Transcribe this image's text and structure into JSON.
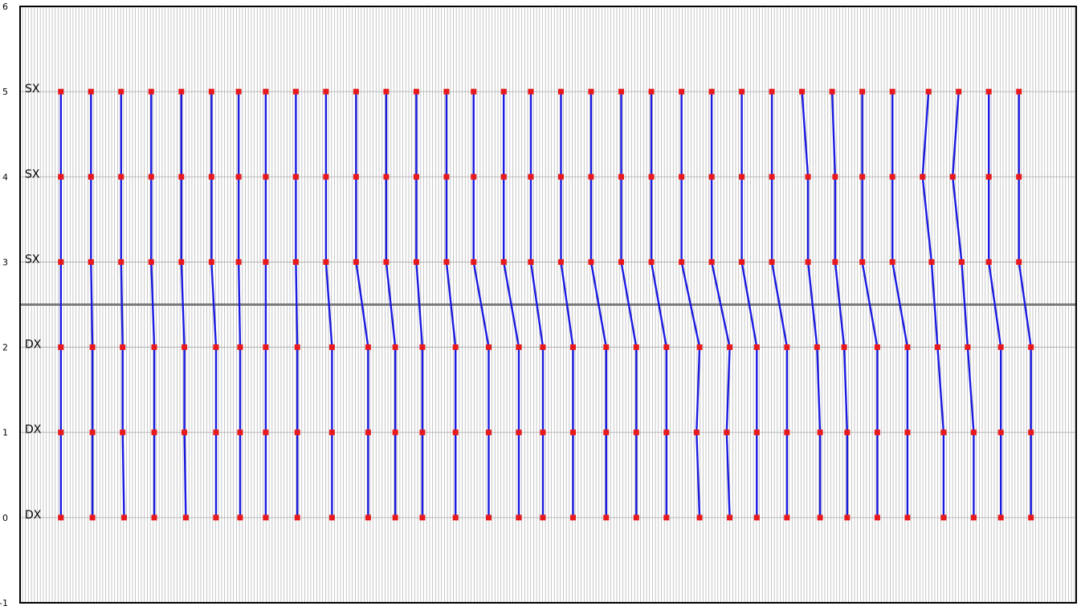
{
  "chart_data": {
    "type": "line",
    "title": "",
    "xlabel": "",
    "ylabel": "",
    "ylim": [
      -1,
      6
    ],
    "xlim": [
      -0.5,
      34.5
    ],
    "y_ticks": [
      "-1",
      "0",
      "1",
      "2",
      "3",
      "4",
      "5",
      "6"
    ],
    "row_labels": [
      {
        "y": 5,
        "text": "SX"
      },
      {
        "y": 4,
        "text": "SX"
      },
      {
        "y": 3,
        "text": "SX"
      },
      {
        "y": 2,
        "text": "DX"
      },
      {
        "y": 1,
        "text": "DX"
      },
      {
        "y": 0,
        "text": "DX"
      }
    ],
    "divider_y": 2.5,
    "grid": true,
    "marker_color": "#e8191c",
    "line_color": "#1a1ae0",
    "series": [
      {
        "points": [
          [
            0.0,
            5
          ],
          [
            0.0,
            4
          ],
          [
            0.0,
            3
          ],
          [
            0.0,
            2
          ],
          [
            0.0,
            1
          ],
          [
            0.0,
            0
          ]
        ]
      },
      {
        "points": [
          [
            1.0,
            5
          ],
          [
            1.0,
            4
          ],
          [
            1.0,
            3
          ],
          [
            1.05,
            2
          ],
          [
            1.05,
            1
          ],
          [
            1.05,
            0
          ]
        ]
      },
      {
        "points": [
          [
            2.0,
            5
          ],
          [
            2.0,
            4
          ],
          [
            2.0,
            3
          ],
          [
            2.05,
            2
          ],
          [
            2.05,
            1
          ],
          [
            2.1,
            0
          ]
        ]
      },
      {
        "points": [
          [
            3.0,
            5
          ],
          [
            3.0,
            4
          ],
          [
            3.0,
            3
          ],
          [
            3.1,
            2
          ],
          [
            3.1,
            1
          ],
          [
            3.1,
            0
          ]
        ]
      },
      {
        "points": [
          [
            4.0,
            5
          ],
          [
            4.0,
            4
          ],
          [
            4.0,
            3
          ],
          [
            4.1,
            2
          ],
          [
            4.1,
            1
          ],
          [
            4.15,
            0
          ]
        ]
      },
      {
        "points": [
          [
            5.0,
            5
          ],
          [
            5.0,
            4
          ],
          [
            5.0,
            3
          ],
          [
            5.15,
            2
          ],
          [
            5.15,
            1
          ],
          [
            5.15,
            0
          ]
        ]
      },
      {
        "points": [
          [
            5.9,
            5
          ],
          [
            5.9,
            4
          ],
          [
            5.9,
            3
          ],
          [
            5.95,
            2
          ],
          [
            5.95,
            1
          ],
          [
            5.95,
            0
          ]
        ]
      },
      {
        "points": [
          [
            6.8,
            5
          ],
          [
            6.8,
            4
          ],
          [
            6.8,
            3
          ],
          [
            6.8,
            2
          ],
          [
            6.8,
            1
          ],
          [
            6.8,
            0
          ]
        ]
      },
      {
        "points": [
          [
            7.8,
            5
          ],
          [
            7.8,
            4
          ],
          [
            7.8,
            3
          ],
          [
            7.85,
            2
          ],
          [
            7.85,
            1
          ],
          [
            7.85,
            0
          ]
        ]
      },
      {
        "points": [
          [
            8.8,
            5
          ],
          [
            8.8,
            4
          ],
          [
            8.8,
            3
          ],
          [
            9.0,
            2
          ],
          [
            9.0,
            1
          ],
          [
            9.0,
            0
          ]
        ]
      },
      {
        "points": [
          [
            9.8,
            5
          ],
          [
            9.8,
            4
          ],
          [
            9.8,
            3
          ],
          [
            10.2,
            2
          ],
          [
            10.2,
            1
          ],
          [
            10.2,
            0
          ]
        ]
      },
      {
        "points": [
          [
            10.8,
            5
          ],
          [
            10.8,
            4
          ],
          [
            10.8,
            3
          ],
          [
            11.1,
            2
          ],
          [
            11.1,
            1
          ],
          [
            11.1,
            0
          ]
        ]
      },
      {
        "points": [
          [
            11.8,
            5
          ],
          [
            11.8,
            4
          ],
          [
            11.8,
            3
          ],
          [
            12.0,
            2
          ],
          [
            12.0,
            1
          ],
          [
            12.0,
            0
          ]
        ]
      },
      {
        "points": [
          [
            12.8,
            5
          ],
          [
            12.8,
            4
          ],
          [
            12.8,
            3
          ],
          [
            13.1,
            2
          ],
          [
            13.1,
            1
          ],
          [
            13.1,
            0
          ]
        ]
      },
      {
        "points": [
          [
            13.7,
            5
          ],
          [
            13.7,
            4
          ],
          [
            13.7,
            3
          ],
          [
            14.2,
            2
          ],
          [
            14.2,
            1
          ],
          [
            14.2,
            0
          ]
        ]
      },
      {
        "points": [
          [
            14.7,
            5
          ],
          [
            14.7,
            4
          ],
          [
            14.7,
            3
          ],
          [
            15.2,
            2
          ],
          [
            15.2,
            1
          ],
          [
            15.2,
            0
          ]
        ]
      },
      {
        "points": [
          [
            15.6,
            5
          ],
          [
            15.6,
            4
          ],
          [
            15.6,
            3
          ],
          [
            16.0,
            2
          ],
          [
            16.0,
            1
          ],
          [
            16.0,
            0
          ]
        ]
      },
      {
        "points": [
          [
            16.6,
            5
          ],
          [
            16.6,
            4
          ],
          [
            16.6,
            3
          ],
          [
            17.0,
            2
          ],
          [
            17.0,
            1
          ],
          [
            17.0,
            0
          ]
        ]
      },
      {
        "points": [
          [
            17.6,
            5
          ],
          [
            17.6,
            4
          ],
          [
            17.6,
            3
          ],
          [
            18.1,
            2
          ],
          [
            18.1,
            1
          ],
          [
            18.1,
            0
          ]
        ]
      },
      {
        "points": [
          [
            18.6,
            5
          ],
          [
            18.6,
            4
          ],
          [
            18.6,
            3
          ],
          [
            19.1,
            2
          ],
          [
            19.1,
            1
          ],
          [
            19.1,
            0
          ]
        ]
      },
      {
        "points": [
          [
            19.6,
            5
          ],
          [
            19.6,
            4
          ],
          [
            19.6,
            3
          ],
          [
            20.1,
            2
          ],
          [
            20.1,
            1
          ],
          [
            20.1,
            0
          ]
        ]
      },
      {
        "points": [
          [
            20.6,
            5
          ],
          [
            20.6,
            4
          ],
          [
            20.6,
            3
          ],
          [
            21.2,
            2
          ],
          [
            21.1,
            1
          ],
          [
            21.2,
            0
          ]
        ]
      },
      {
        "points": [
          [
            21.6,
            5
          ],
          [
            21.6,
            4
          ],
          [
            21.6,
            3
          ],
          [
            22.2,
            2
          ],
          [
            22.1,
            1
          ],
          [
            22.2,
            0
          ]
        ]
      },
      {
        "points": [
          [
            22.6,
            5
          ],
          [
            22.6,
            4
          ],
          [
            22.6,
            3
          ],
          [
            23.1,
            2
          ],
          [
            23.1,
            1
          ],
          [
            23.1,
            0
          ]
        ]
      },
      {
        "points": [
          [
            23.6,
            5
          ],
          [
            23.6,
            4
          ],
          [
            23.6,
            3
          ],
          [
            24.1,
            2
          ],
          [
            24.1,
            1
          ],
          [
            24.1,
            0
          ]
        ]
      },
      {
        "points": [
          [
            24.6,
            5
          ],
          [
            24.8,
            4
          ],
          [
            24.8,
            3
          ],
          [
            25.1,
            2
          ],
          [
            25.2,
            1
          ],
          [
            25.2,
            0
          ]
        ]
      },
      {
        "points": [
          [
            25.6,
            5
          ],
          [
            25.7,
            4
          ],
          [
            25.7,
            3
          ],
          [
            26.0,
            2
          ],
          [
            26.1,
            1
          ],
          [
            26.1,
            0
          ]
        ]
      },
      {
        "points": [
          [
            26.6,
            5
          ],
          [
            26.6,
            4
          ],
          [
            26.6,
            3
          ],
          [
            27.1,
            2
          ],
          [
            27.1,
            1
          ],
          [
            27.1,
            0
          ]
        ]
      },
      {
        "points": [
          [
            27.6,
            5
          ],
          [
            27.6,
            4
          ],
          [
            27.6,
            3
          ],
          [
            28.1,
            2
          ],
          [
            28.1,
            1
          ],
          [
            28.1,
            0
          ]
        ]
      },
      {
        "points": [
          [
            28.8,
            5
          ],
          [
            28.6,
            4
          ],
          [
            28.9,
            3
          ],
          [
            29.1,
            2
          ],
          [
            29.3,
            1
          ],
          [
            29.3,
            0
          ]
        ]
      },
      {
        "points": [
          [
            29.8,
            5
          ],
          [
            29.6,
            4
          ],
          [
            29.9,
            3
          ],
          [
            30.1,
            2
          ],
          [
            30.3,
            1
          ],
          [
            30.3,
            0
          ]
        ]
      },
      {
        "points": [
          [
            30.8,
            5
          ],
          [
            30.8,
            4
          ],
          [
            30.8,
            3
          ],
          [
            31.2,
            2
          ],
          [
            31.2,
            1
          ],
          [
            31.2,
            0
          ]
        ]
      },
      {
        "points": [
          [
            31.8,
            5
          ],
          [
            31.8,
            4
          ],
          [
            31.8,
            3
          ],
          [
            32.2,
            2
          ],
          [
            32.2,
            1
          ],
          [
            32.2,
            0
          ]
        ]
      }
    ]
  }
}
